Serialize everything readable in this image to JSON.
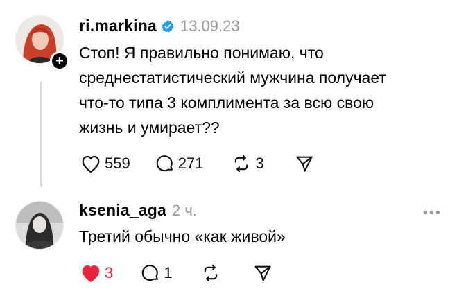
{
  "post1": {
    "username": "ri.markina",
    "verified": true,
    "time": "13.09.23",
    "text_lines": [
      "Стоп! Я правильно понимаю, что",
      "среднестатистический мужчина получает",
      "что-то типа 3 комплимента за всю свою",
      "жизнь и умирает??"
    ],
    "likes": "559",
    "comments": "271",
    "reposts": "3"
  },
  "post2": {
    "username": "ksenia_aga",
    "time": "2 ч.",
    "text": "Третий обычно «как живой»",
    "likes": "3",
    "comments": "1",
    "liked": true
  },
  "icons": {
    "follow": "plus-icon",
    "verified": "verified-badge-icon",
    "like": "heart-icon",
    "comment": "comment-bubble-icon",
    "repost": "repost-icon",
    "share": "share-send-icon",
    "more": "more-dots-icon"
  },
  "colors": {
    "verified": "#1d9bf0",
    "liked": "#e8243b",
    "muted": "#9a9a9a",
    "thread_line": "#d9d9d9"
  }
}
